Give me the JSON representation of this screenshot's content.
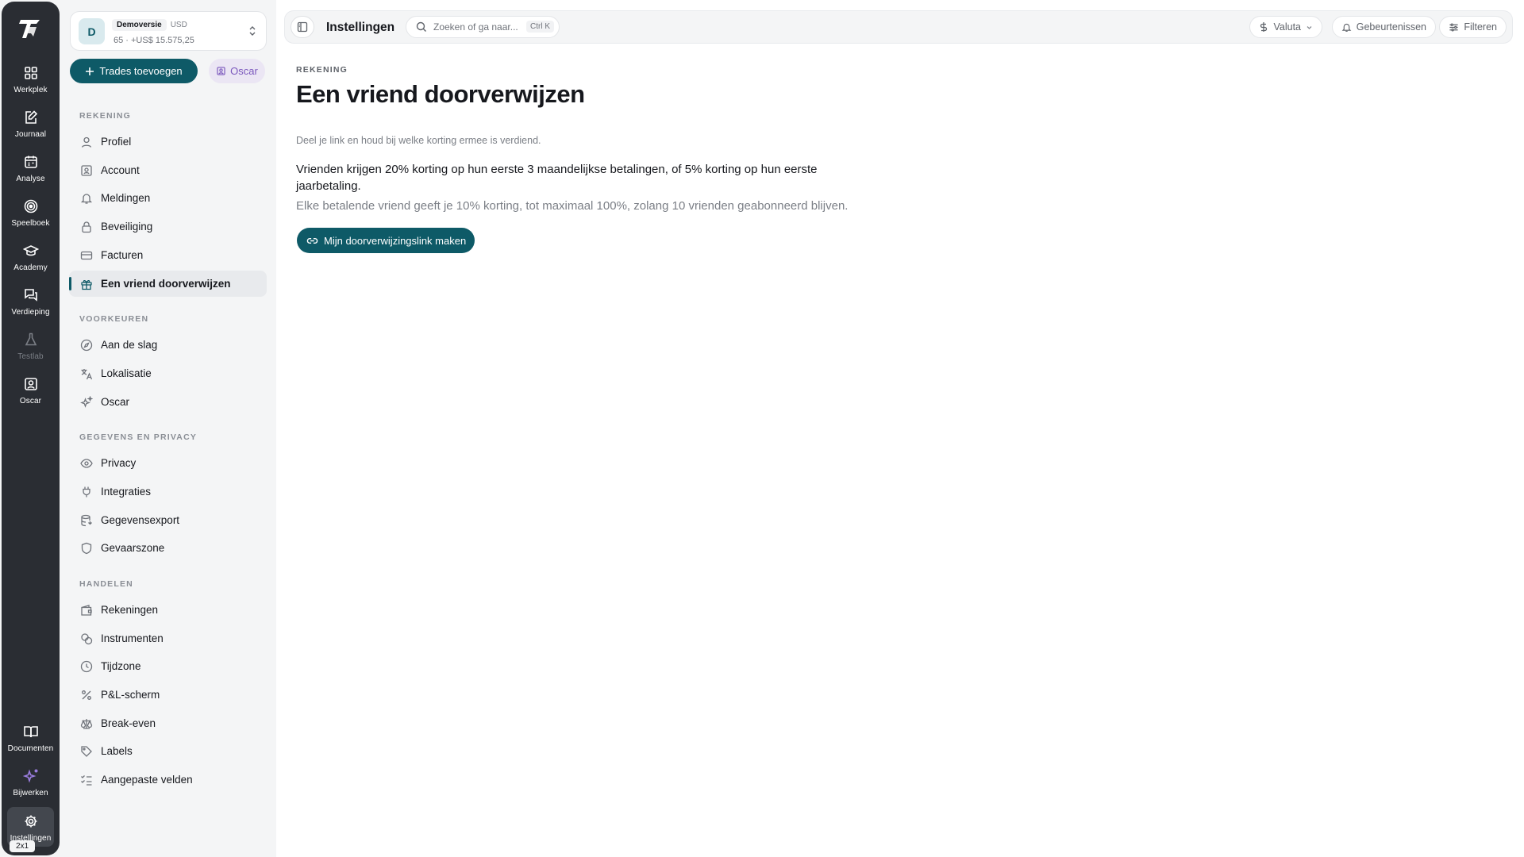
{
  "rail": {
    "items": [
      {
        "label": "Werkplek",
        "icon": "grid-icon"
      },
      {
        "label": "Journaal",
        "icon": "notebook-pen-icon"
      },
      {
        "label": "Analyse",
        "icon": "calendar-icon"
      },
      {
        "label": "Speelboek",
        "icon": "target-icon"
      },
      {
        "label": "Academy",
        "icon": "graduation-cap-icon"
      },
      {
        "label": "Verdieping",
        "icon": "messages-icon"
      },
      {
        "label": "Testlab",
        "icon": "flask-icon",
        "disabled": true
      },
      {
        "label": "Oscar",
        "icon": "portrait-icon"
      }
    ],
    "bottom": [
      {
        "label": "Documenten",
        "icon": "book-open-icon"
      },
      {
        "label": "Bijwerken",
        "icon": "sparkles-icon"
      },
      {
        "label": "Instellingen",
        "icon": "gear-icon",
        "active": true
      }
    ],
    "badge": "2x1"
  },
  "account": {
    "avatar": "D",
    "name": "Demoversie",
    "currency": "USD",
    "summary": "65 · +US$ 15.575,25"
  },
  "actions": {
    "add_trades": "Trades toevoegen",
    "oscar": "Oscar"
  },
  "sidebar": {
    "sections": [
      {
        "title": "REKENING",
        "items": [
          {
            "label": "Profiel",
            "icon": "user-icon"
          },
          {
            "label": "Account",
            "icon": "id-badge-icon"
          },
          {
            "label": "Meldingen",
            "icon": "bell-icon"
          },
          {
            "label": "Beveiliging",
            "icon": "lock-icon"
          },
          {
            "label": "Facturen",
            "icon": "credit-card-icon"
          },
          {
            "label": "Een vriend doorverwijzen",
            "icon": "gift-icon",
            "active": true
          }
        ]
      },
      {
        "title": "VOORKEUREN",
        "items": [
          {
            "label": "Aan de slag",
            "icon": "compass-icon"
          },
          {
            "label": "Lokalisatie",
            "icon": "translate-icon"
          },
          {
            "label": "Oscar",
            "icon": "sparkles-icon"
          }
        ]
      },
      {
        "title": "GEGEVENS EN PRIVACY",
        "items": [
          {
            "label": "Privacy",
            "icon": "eye-icon"
          },
          {
            "label": "Integraties",
            "icon": "plug-icon"
          },
          {
            "label": "Gegevensexport",
            "icon": "database-icon"
          },
          {
            "label": "Gevaarszone",
            "icon": "shield-icon"
          }
        ]
      },
      {
        "title": "HANDELEN",
        "items": [
          {
            "label": "Rekeningen",
            "icon": "wallet-icon"
          },
          {
            "label": "Instrumenten",
            "icon": "coins-icon"
          },
          {
            "label": "Tijdzone",
            "icon": "clock-icon"
          },
          {
            "label": "P&L-scherm",
            "icon": "percent-icon"
          },
          {
            "label": "Break-even",
            "icon": "scale-icon"
          },
          {
            "label": "Labels",
            "icon": "tag-icon"
          },
          {
            "label": "Aangepaste velden",
            "icon": "list-checks-icon"
          }
        ]
      }
    ]
  },
  "topbar": {
    "title": "Instellingen",
    "search_placeholder": "Zoeken of ga naar...",
    "search_shortcut": "Ctrl K",
    "currency": "Valuta",
    "events": "Gebeurtenissen",
    "filters": "Filteren"
  },
  "page": {
    "breadcrumb": "REKENING",
    "title": "Een vriend doorverwijzen",
    "description": "Deel je link en houd bij welke korting ermee is verdiend.",
    "body1": "Vrienden krijgen 20% korting op hun eerste 3 maandelijkse betalingen, of 5% korting op hun eerste jaarbetaling.",
    "body2": "Elke betalende vriend geeft je 10% korting, tot maximaal 100%, zolang 10 vrienden geabonneerd blijven.",
    "cta": "Mijn doorverwijzingslink maken"
  },
  "colors": {
    "accent": "#0e5a67",
    "rail": "#2a2d33",
    "oscar": "#7b58bd"
  }
}
